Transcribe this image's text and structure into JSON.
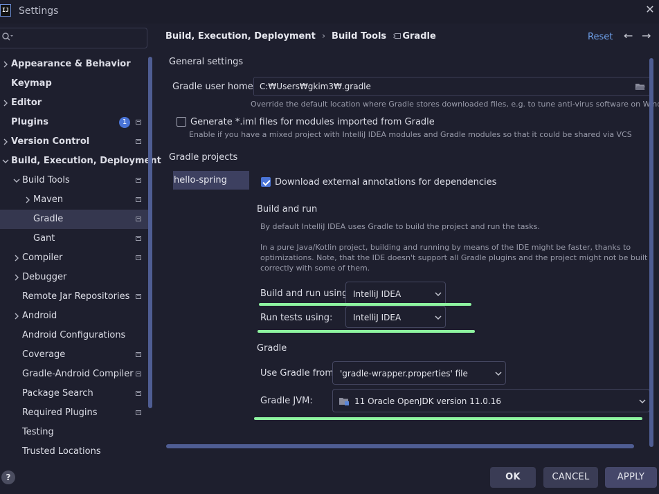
{
  "window": {
    "title": "Settings",
    "logo_text": "IJ",
    "close_glyph": "✕"
  },
  "sidebar": {
    "search_placeholder": "",
    "search_icon": "magnifier-dropdown",
    "items": [
      {
        "label": "Appearance & Behavior",
        "bold": true,
        "expandable": true,
        "level": 0
      },
      {
        "label": "Keymap",
        "bold": true,
        "expandable": false,
        "level": 0
      },
      {
        "label": "Editor",
        "bold": true,
        "expandable": true,
        "level": 0
      },
      {
        "label": "Plugins",
        "bold": true,
        "expandable": false,
        "level": 0,
        "badge": "1",
        "config": true
      },
      {
        "label": "Version Control",
        "bold": true,
        "expandable": true,
        "level": 0,
        "config": true
      },
      {
        "label": "Build, Execution, Deployment",
        "bold": true,
        "expandable": true,
        "expanded": true,
        "level": 0
      },
      {
        "label": "Build Tools",
        "bold": false,
        "expandable": true,
        "expanded": true,
        "level": 1,
        "config": true
      },
      {
        "label": "Maven",
        "bold": false,
        "expandable": true,
        "level": 2,
        "config": true
      },
      {
        "label": "Gradle",
        "bold": false,
        "expandable": false,
        "level": 2,
        "config": true,
        "selected": true
      },
      {
        "label": "Gant",
        "bold": false,
        "expandable": false,
        "level": 2,
        "config": true
      },
      {
        "label": "Compiler",
        "bold": false,
        "expandable": true,
        "level": 1,
        "config": true
      },
      {
        "label": "Debugger",
        "bold": false,
        "expandable": true,
        "level": 1
      },
      {
        "label": "Remote Jar Repositories",
        "bold": false,
        "expandable": false,
        "level": 1,
        "config": true
      },
      {
        "label": "Android",
        "bold": false,
        "expandable": true,
        "level": 1
      },
      {
        "label": "Android Configurations",
        "bold": false,
        "expandable": false,
        "level": 1
      },
      {
        "label": "Coverage",
        "bold": false,
        "expandable": false,
        "level": 1,
        "config": true
      },
      {
        "label": "Gradle-Android Compiler",
        "bold": false,
        "expandable": false,
        "level": 1,
        "config": true
      },
      {
        "label": "Package Search",
        "bold": false,
        "expandable": false,
        "level": 1,
        "config": true
      },
      {
        "label": "Required Plugins",
        "bold": false,
        "expandable": false,
        "level": 1,
        "config": true
      },
      {
        "label": "Testing",
        "bold": false,
        "expandable": false,
        "level": 1
      },
      {
        "label": "Trusted Locations",
        "bold": false,
        "expandable": false,
        "level": 1
      }
    ]
  },
  "header": {
    "breadcrumb": [
      "Build, Execution, Deployment",
      "Build Tools",
      "Gradle"
    ],
    "breadcrumb_sep": "›",
    "reset_label": "Reset",
    "back_glyph": "←",
    "forward_glyph": "→"
  },
  "general": {
    "section_title": "General settings",
    "user_home_label": "Gradle user home:",
    "user_home_value": "C:₩Users₩gkim3₩.gradle",
    "user_home_hint": "Override the default location where Gradle stores downloaded files, e.g. to tune anti-virus software on Windows",
    "iml_label": "Generate *.iml files for modules imported from Gradle",
    "iml_checked": false,
    "iml_hint": "Enable if you have a mixed project with IntelliJ IDEA modules and Gradle modules so that it could be shared via VCS"
  },
  "projects": {
    "section_title": "Gradle projects",
    "list": [
      "hello-spring"
    ],
    "download_annotations_label": "Download external annotations for dependencies",
    "download_annotations_checked": true
  },
  "build_and_run": {
    "section_title": "Build and run",
    "hint1": "By default IntelliJ IDEA uses Gradle to build the project and run the tasks.",
    "hint2_line1": "In a pure Java/Kotlin project, building and running by means of the IDE might be faster, thanks to",
    "hint2_line2": "optimizations. Note, that the IDE doesn't support all Gradle plugins and the project might not be built",
    "hint2_line3": "correctly with some of them.",
    "build_run_label": "Build and run using:",
    "build_run_value": "IntelliJ IDEA",
    "run_tests_label": "Run tests using:",
    "run_tests_value": "IntelliJ IDEA"
  },
  "gradle": {
    "section_title": "Gradle",
    "use_from_label": "Use Gradle from:",
    "use_from_value": "'gradle-wrapper.properties' file",
    "jvm_label": "Gradle JVM:",
    "jvm_value": "11 Oracle OpenJDK version 11.0.16"
  },
  "footer": {
    "help_glyph": "?",
    "ok_label": "OK",
    "cancel_label": "CANCEL",
    "apply_label": "APPLY"
  },
  "colors": {
    "background": "#1e1f2e",
    "selection": "#35374f",
    "accent": "#4a74d6",
    "link": "#6d9fe8",
    "highlight": "#8ef3a0"
  }
}
